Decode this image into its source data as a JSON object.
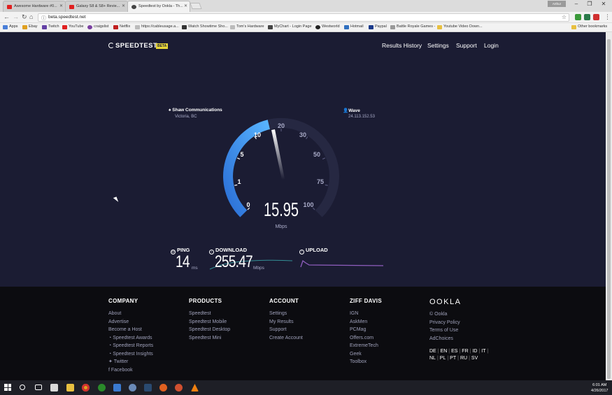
{
  "browser": {
    "tabs": [
      {
        "title": "Awesome Hardware #0...",
        "active": false,
        "fav_color": "#e02020"
      },
      {
        "title": "Galaxy S8 & S8+ Revie...",
        "active": false,
        "fav_color": "#e02020"
      },
      {
        "title": "Speedtest by Ookla - Th...",
        "active": true,
        "fav_color": "#444444"
      }
    ],
    "user_badge": "Arthur",
    "url": "beta.speedtest.net",
    "bookmarks": [
      {
        "label": "Apps",
        "color": "#4a7fd8"
      },
      {
        "label": "Ebay",
        "color": "#e0a020"
      },
      {
        "label": "Twitch",
        "color": "#6441a5"
      },
      {
        "label": "YouTube",
        "color": "#e02020"
      },
      {
        "label": "craigslist",
        "color": "#7a3fa0"
      },
      {
        "label": "Netflix",
        "color": "#c02020"
      },
      {
        "label": "https://cableusage.a...",
        "color": "#888888"
      },
      {
        "label": "Watch Showtime Sho...",
        "color": "#333333"
      },
      {
        "label": "Tom's Hardware",
        "color": "#888888"
      },
      {
        "label": "MyChart - Login Page",
        "color": "#444444"
      },
      {
        "label": "Westworld",
        "color": "#222222"
      },
      {
        "label": "Hotmail",
        "color": "#3070c0"
      },
      {
        "label": "Paypal",
        "color": "#1a3a8a"
      },
      {
        "label": "Battle Royale Games -",
        "color": "#999999"
      },
      {
        "label": "Youtube Video Down...",
        "color": "#e8c040"
      }
    ],
    "other_bookmarks": "Other bookmarks"
  },
  "header": {
    "logo": "SPEEDTEST",
    "badge": "BETA",
    "nav": [
      "Results History",
      "Settings",
      "Support",
      "Login"
    ]
  },
  "isp": {
    "name": "Shaw Communications",
    "location": "Victoria, BC"
  },
  "server": {
    "name": "Wave",
    "ip": "24.113.152.53"
  },
  "gauge": {
    "ticks": [
      "0",
      "1",
      "5",
      "10",
      "20",
      "30",
      "50",
      "75",
      "100"
    ],
    "value": "15.95",
    "unit": "Mbps",
    "fill_fraction": 0.45,
    "accent": "#4aa3ff"
  },
  "metrics": {
    "ping": {
      "label": "PING",
      "value": "14",
      "unit": "ms"
    },
    "download": {
      "label": "DOWNLOAD",
      "value": "255.47",
      "unit": "Mbps"
    },
    "upload": {
      "label": "UPLOAD"
    }
  },
  "footer": {
    "columns": [
      {
        "heading": "COMPANY",
        "items": [
          "About",
          "Advertise",
          "Become a Host",
          "Speedtest Awards",
          "Speedtest Reports",
          "Speedtest Insights",
          "Twitter",
          "Facebook"
        ]
      },
      {
        "heading": "PRODUCTS",
        "items": [
          "Speedtest",
          "Speedtest Mobile",
          "Speedtest Desktop",
          "Speedtest Mini"
        ]
      },
      {
        "heading": "ACCOUNT",
        "items": [
          "Settings",
          "My Results",
          "Support",
          "Create Account"
        ]
      },
      {
        "heading": "ZIFF DAVIS",
        "items": [
          "IGN",
          "AskMen",
          "PCMag",
          "Offers.com",
          "ExtremeTech",
          "Geek",
          "Toolbox"
        ]
      }
    ],
    "ookla": {
      "logo": "OOKLA",
      "items": [
        "© Ookla",
        "Privacy Policy",
        "Terms of Use",
        "AdChoices"
      ],
      "languages_row1": [
        "DE",
        "EN",
        "ES",
        "FR",
        "ID",
        "IT"
      ],
      "languages_row2": [
        "NL",
        "PL",
        "PT",
        "RU",
        "SV"
      ]
    }
  },
  "taskbar": {
    "time": "6:01 AM",
    "date": "4/26/2017"
  }
}
